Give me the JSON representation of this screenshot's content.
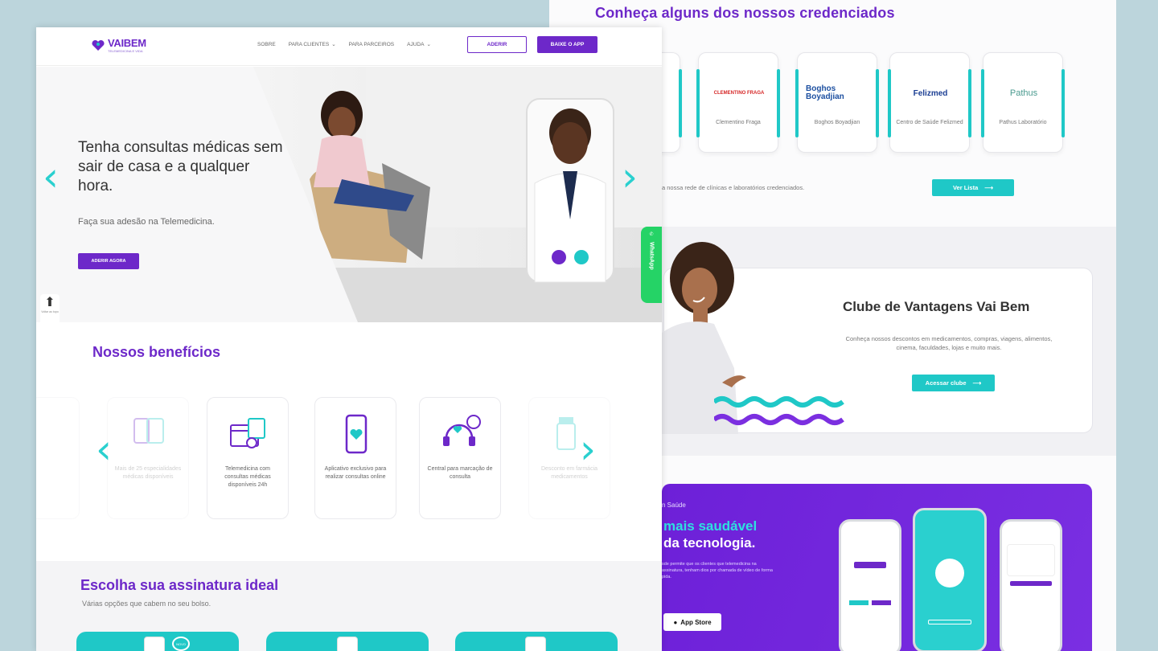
{
  "back_page": {
    "title": "Conheça alguns dos nossos credenciados",
    "partners": [
      {
        "logo": "CLEMENTINO FRAGA",
        "name": "Clementino Fraga"
      },
      {
        "logo": "Boghos Boyadjian",
        "name": "Boghos Boyadjian"
      },
      {
        "logo": "Felizmed",
        "name": "Centro de Saúde Felizmed"
      },
      {
        "logo": "Pathus",
        "name": "Pathus Laboratório"
      }
    ],
    "network_text": "a nossa rede de clínicas e laboratórios credenciados.",
    "ver_lista_label": "Ver Lista",
    "club": {
      "title": "Clube de Vantagens Vai Bem",
      "text": "Conheça nossos descontos em medicamentos, compras, viagens, alimentos, cinema, faculdades, lojas e muito mais.",
      "button_label": "Acessar clube"
    },
    "promo": {
      "small": "n Saúde",
      "line1": "mais saudável",
      "line2": "da tecnologia.",
      "text": "sde permite que os clientes que telemedicina na assinatura, tenham dios por chamada de vídeo de forma pida.",
      "appstore_label": "App Store"
    }
  },
  "front_page": {
    "logo": {
      "word": "VAIBEM",
      "tagline": "TELEMEDICINA E VIDA"
    },
    "nav": {
      "sobre": "SOBRE",
      "clientes": "PARA CLIENTES",
      "parceiros": "PARA PARCEIROS",
      "ajuda": "AJUDA"
    },
    "aderir_label": "ADERIR",
    "baixe_app_label": "BAIXE O APP",
    "hero": {
      "title": "Tenha consultas médicas sem sair de casa e a qualquer hora.",
      "subtitle": "Faça sua adesão na Telemedicina.",
      "button_label": "ADERIR AGORA"
    },
    "back_to_top": "Voltar ao topo",
    "whatsapp_label": "WhatsApp",
    "benefits": {
      "title": "Nossos benefícios",
      "items": [
        {
          "text": "Mais de 25 especialidades médicas disponíveis",
          "icon": "multi-device-icon"
        },
        {
          "text": "Telemedicina com consultas médicas disponíveis 24h",
          "icon": "calendar-icon"
        },
        {
          "text": "Aplicativo exclusivo para realizar consultas online",
          "icon": "phone-heart-icon"
        },
        {
          "text": "Central para marcação de consulta",
          "icon": "headset-clock-icon"
        },
        {
          "text": "Desconto em farmácia medicamentos",
          "icon": "pill-bottle-icon"
        }
      ]
    },
    "plans": {
      "title": "Escolha sua assinatura ideal",
      "subtitle": "Várias opções que cabem no seu bolso.",
      "novo_badge": "NOVO"
    }
  },
  "colors": {
    "purple": "#6d28c9",
    "teal": "#1fc8c7",
    "whatsapp": "#25d366"
  }
}
